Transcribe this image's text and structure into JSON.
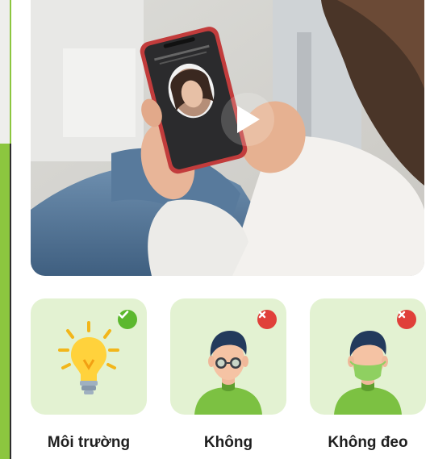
{
  "colors": {
    "accent_green": "#8cc63f",
    "tile_bg": "#e3f2d2",
    "ok_badge": "#5cb82e",
    "no_badge": "#e0403a"
  },
  "video": {
    "play_icon": "play-icon"
  },
  "requirements": [
    {
      "label": "Môi trường",
      "status": "ok",
      "icon": "light-bulb-icon"
    },
    {
      "label": "Không",
      "status": "no",
      "icon": "person-glasses-icon"
    },
    {
      "label": "Không đeo",
      "status": "no",
      "icon": "person-mask-icon"
    }
  ]
}
